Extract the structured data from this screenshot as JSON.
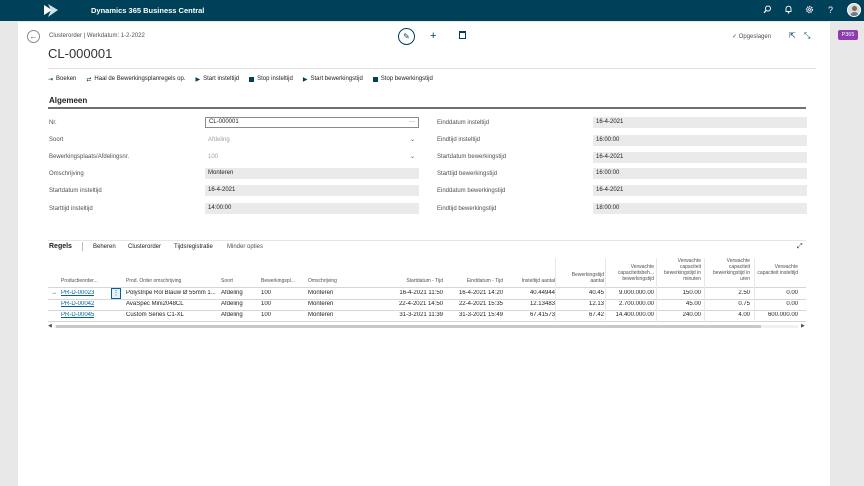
{
  "topbar": {
    "app_title": "Dynamics 365 Business Central"
  },
  "header": {
    "breadcrumb": "Clusterorder | Werkdatum: 1-2-2022",
    "title": "CL-000001",
    "saved_label": "Opgeslagen",
    "badge": "P365"
  },
  "actions": [
    {
      "label": "Boeken"
    },
    {
      "label": "Haal de Bewerkingsplanregels op."
    },
    {
      "label": "Start insteltijd"
    },
    {
      "label": "Stop insteltijd"
    },
    {
      "label": "Start bewerkingstijd"
    },
    {
      "label": "Stop bewerkingstijd"
    }
  ],
  "general": {
    "section_title": "Algemeen",
    "left": [
      {
        "label": "Nr.",
        "value": "CL-000001"
      },
      {
        "label": "Soort",
        "value": "Afdeling"
      },
      {
        "label": "Bewerkingsplaats/Afdelingsnr.",
        "value": "100"
      },
      {
        "label": "Omschrijving",
        "value": "Monteren"
      },
      {
        "label": "Startdatum insteltijd",
        "value": "16-4-2021"
      },
      {
        "label": "Starttijd insteltijd",
        "value": "14:00:00"
      }
    ],
    "right": [
      {
        "label": "Einddatum insteltijd",
        "value": "16-4-2021"
      },
      {
        "label": "Eindtijd insteltijd",
        "value": "16:00:00"
      },
      {
        "label": "Startdatum bewerkingstijd",
        "value": "16-4-2021"
      },
      {
        "label": "Starttijd bewerkingstijd",
        "value": "16:00:00"
      },
      {
        "label": "Einddatum bewerkingstijd",
        "value": "16-4-2021"
      },
      {
        "label": "Eindtijd bewerkingstijd",
        "value": "18:00:00"
      }
    ]
  },
  "lines": {
    "title": "Regels",
    "tabs": [
      "Beheren",
      "Clusterorder",
      "Tijdsregistratie",
      "Minder opties"
    ],
    "columns": [
      "Productieorder...",
      "Prod. Order omschrijving",
      "Soort",
      "Bewerkingspl...",
      "Omschrijving",
      "Startdatum - Tijd",
      "Einddatum - Tijd",
      "Insteltijd aantal",
      "Bewerkingstijd aantal",
      "Verwachte capaciteitsbeh... bewerkingstijd",
      "Verwachte capaciteit bewerkingstijd in minuten",
      "Verwachte capaciteit bewerkingstijd in uren",
      "Verwachte capaciteit insteltijd"
    ],
    "rows": [
      [
        "PR-D-00023",
        "Polystripe Rol Blauw Ø 55mm 1...",
        "Afdeling",
        "100",
        "Monteren",
        "16-4-2021 11:50",
        "16-4-2021 14:20",
        "40.44944",
        "40.45",
        "9.000.000.00",
        "150.00",
        "2.50",
        "0.00"
      ],
      [
        "PR-D-00042",
        "AvaSpec Mini2048CL",
        "Afdeling",
        "100",
        "Monteren",
        "22-4-2021 14:50",
        "22-4-2021 15:35",
        "12.13483",
        "12.13",
        "2.700.000.00",
        "45.00",
        "0.75",
        "0.00"
      ],
      [
        "PR-D-00045",
        "Custom Series C1-XL",
        "Afdeling",
        "100",
        "Monteren",
        "31-3-2021 11:39",
        "31-3-2021 15:49",
        "67.41573",
        "67.42",
        "14.400.000.00",
        "240.00",
        "4.00",
        "600.000.00"
      ]
    ]
  },
  "colors": {
    "topbar": "#00415a",
    "accent": "#00619e",
    "badge": "#8e3cb0"
  }
}
